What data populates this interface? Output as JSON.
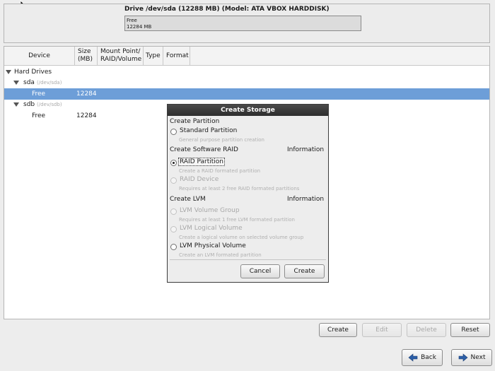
{
  "drive": {
    "title": "Drive /dev/sda (12288 MB) (Model: ATA VBOX HARDDISK)",
    "bar_label": "Free",
    "bar_size": "12284 MB"
  },
  "table": {
    "columns": [
      "Device",
      "Size\n(MB)",
      "Mount Point/\nRAID/Volume",
      "Type",
      "Format"
    ],
    "col_device": "Device",
    "col_size_1": "Size",
    "col_size_2": "(MB)",
    "col_mount_1": "Mount Point/",
    "col_mount_2": "RAID/Volume",
    "col_type": "Type",
    "col_format": "Format",
    "root": "Hard Drives",
    "disks": [
      {
        "name": "sda",
        "path": "(/dev/sda)",
        "child": "Free",
        "size": "12284"
      },
      {
        "name": "sdb",
        "path": "(/dev/sdb)",
        "child": "Free",
        "size": "12284"
      }
    ]
  },
  "dialog": {
    "title": "Create Storage",
    "sec_partition": "Create Partition",
    "standard": "Standard Partition",
    "standard_desc": "General purpose partition creation",
    "sec_raid": "Create Software RAID",
    "info": "Information",
    "raid_partition": "RAID Partition",
    "raid_partition_desc": "Create a RAID formated partition",
    "raid_device": "RAID Device",
    "raid_device_desc": "Requires at least 2 free RAID formated partitions",
    "sec_lvm": "Create LVM",
    "lvm_vg": "LVM Volume Group",
    "lvm_vg_desc": "Requires at least 1 free LVM formated partition",
    "lvm_lv": "LVM Logical Volume",
    "lvm_lv_desc": "Create a logical volume on selected volume group",
    "lvm_pv": "LVM Physical Volume",
    "lvm_pv_desc": "Create an LVM formated partition",
    "cancel": "Cancel",
    "create": "Create"
  },
  "actions": {
    "create": "Create",
    "edit": "Edit",
    "delete": "Delete",
    "reset": "Reset"
  },
  "nav": {
    "back": "Back",
    "next": "Next"
  }
}
